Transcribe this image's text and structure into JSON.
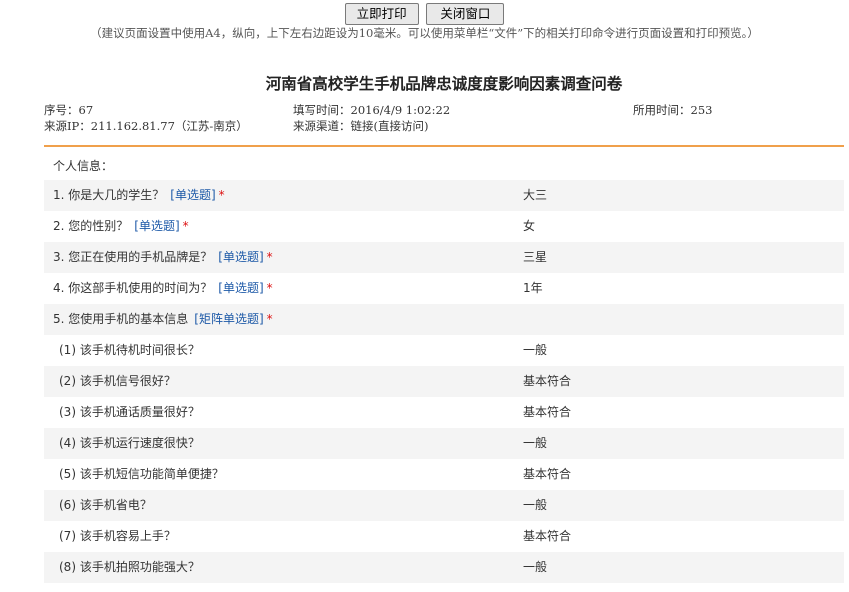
{
  "toolbar": {
    "print_label": "立即打印",
    "close_label": "关闭窗口"
  },
  "tip": "（建议页面设置中使用A4，纵向，上下左右边距设为10毫米。可以使用菜单栏“文件”下的相关打印命令进行页面设置和打印预览。）",
  "title": "河南省高校学生手机品牌忠诚度度影响因素调查问卷",
  "meta": {
    "serial": "序号：67",
    "fill_time": "填写时间：2016/4/9 1:02:22",
    "time_used": "所用时间：253",
    "source_ip": "来源IP：211.162.81.77（江苏-南京）",
    "source_channel": "来源渠道：链接(直接访问)"
  },
  "section_title": "个人信息：",
  "questions": [
    {
      "text": "1. 你是大几的学生？",
      "type": "[单选题]",
      "required": "*",
      "answer": "大三"
    },
    {
      "text": "2. 您的性别？",
      "type": "[单选题]",
      "required": "*",
      "answer": "女"
    },
    {
      "text": "3. 您正在使用的手机品牌是？",
      "type": "[单选题]",
      "required": "*",
      "answer": "三星"
    },
    {
      "text": "4. 你这部手机使用的时间为？",
      "type": "[单选题]",
      "required": "*",
      "answer": "1年"
    },
    {
      "text": "5. 您使用手机的基本信息",
      "type": "[矩阵单选题]",
      "required": "*",
      "answer": ""
    }
  ],
  "matrix_items": [
    {
      "text": "(1) 该手机待机时间很长？",
      "answer": "一般"
    },
    {
      "text": "(2) 该手机信号很好？",
      "answer": "基本符合"
    },
    {
      "text": "(3) 该手机通话质量很好？",
      "answer": "基本符合"
    },
    {
      "text": "(4) 该手机运行速度很快？",
      "answer": "一般"
    },
    {
      "text": "(5) 该手机短信功能简单便捷？",
      "answer": "基本符合"
    },
    {
      "text": "(6) 该手机省电？",
      "answer": "一般"
    },
    {
      "text": "(7) 该手机容易上手？",
      "answer": "基本符合"
    },
    {
      "text": "(8) 该手机拍照功能强大？",
      "answer": "一般"
    }
  ]
}
